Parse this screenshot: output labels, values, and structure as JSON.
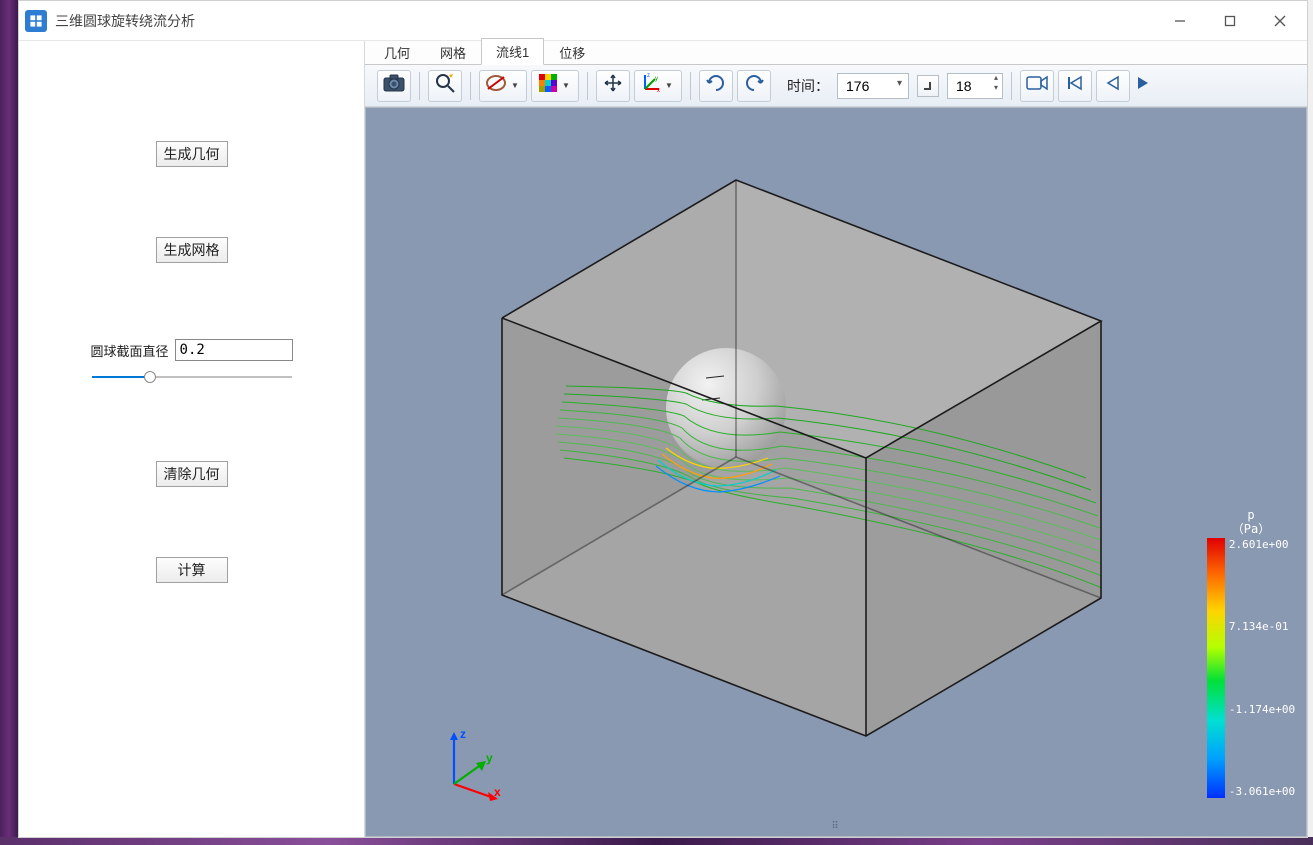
{
  "window": {
    "title": "三维圆球旋转绕流分析"
  },
  "sidebar": {
    "btn_geometry": "生成几何",
    "btn_mesh": "生成网格",
    "diam_label": "圆球截面直径",
    "diam_value": "0.2",
    "btn_clear": "清除几何",
    "btn_compute": "计算"
  },
  "tabs": {
    "geom": "几何",
    "mesh": "网格",
    "streamline": "流线1",
    "displacement": "位移",
    "active": "streamline"
  },
  "toolbar": {
    "time_label": "时间：",
    "time_value": "176",
    "frame_value": "18"
  },
  "legend": {
    "var": "p",
    "unit": "（Pa）",
    "max": "2.601e+00",
    "v2": "7.134e-01",
    "v3": "-1.174e+00",
    "min": "-3.061e+00"
  },
  "axes": {
    "x": "x",
    "y": "y",
    "z": "z"
  }
}
